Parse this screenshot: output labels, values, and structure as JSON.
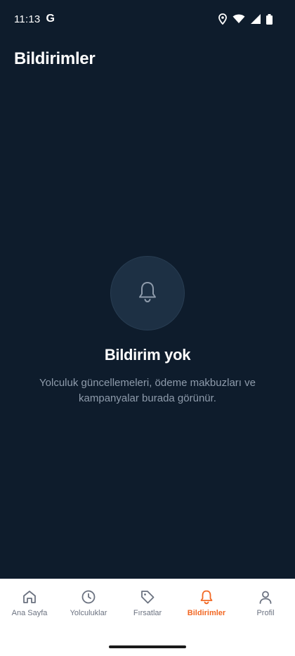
{
  "status_bar": {
    "time": "11:13",
    "google_badge": "G",
    "icons": [
      "location-icon",
      "wifi-icon",
      "signal-icon",
      "battery-icon"
    ]
  },
  "header": {
    "title": "Bildirimler"
  },
  "empty_state": {
    "icon": "bell-icon",
    "title": "Bildirim yok",
    "description": "Yolculuk güncellemeleri, ödeme makbuzları ve kampanyalar burada görünür."
  },
  "bottom_nav": {
    "items": [
      {
        "label": "Ana Sayfa",
        "icon": "home-icon",
        "active": false
      },
      {
        "label": "Yolculuklar",
        "icon": "clock-icon",
        "active": false
      },
      {
        "label": "Fırsatlar",
        "icon": "tag-icon",
        "active": false
      },
      {
        "label": "Bildirimler",
        "icon": "bell-icon",
        "active": true
      },
      {
        "label": "Profil",
        "icon": "user-icon",
        "active": false
      }
    ]
  },
  "colors": {
    "background": "#0e1c2c",
    "accent": "#f26722",
    "nav_inactive": "#6b7280",
    "muted_text": "#8e9bab"
  }
}
